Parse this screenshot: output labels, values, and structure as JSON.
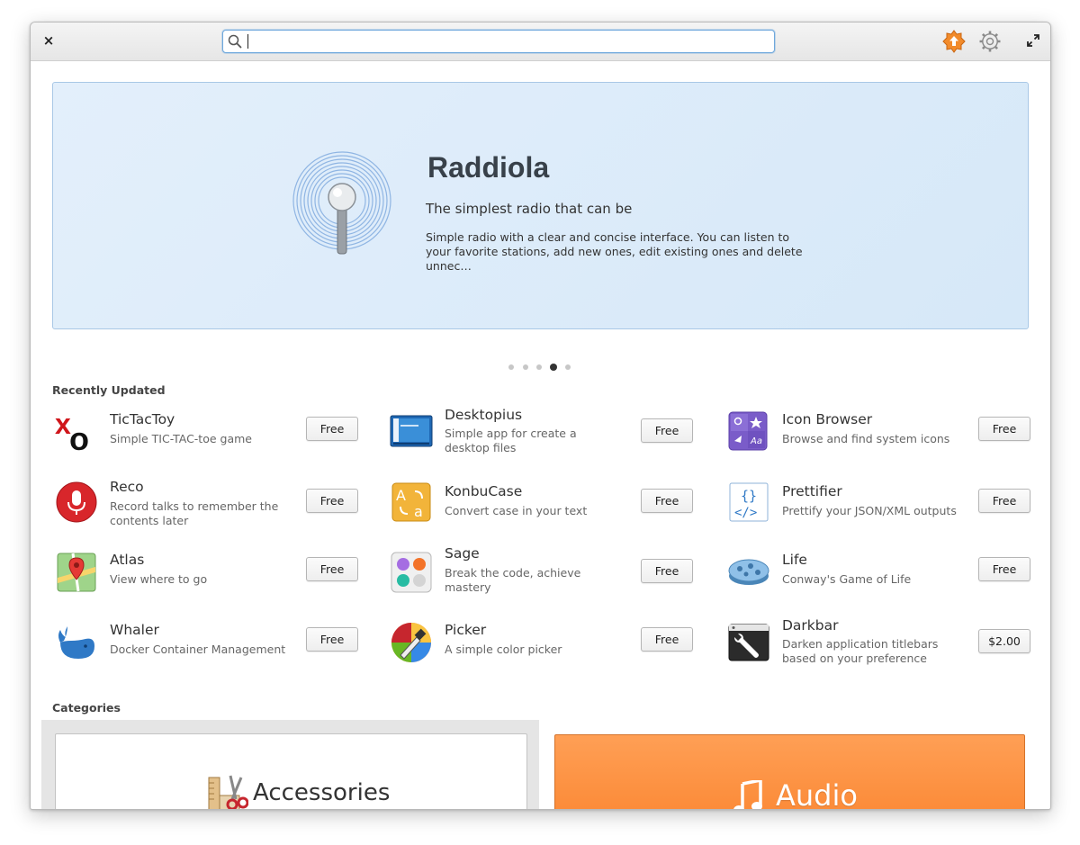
{
  "titlebar": {
    "close_symbol": "×",
    "search": {
      "value": "",
      "placeholder": ""
    },
    "icons": [
      "updates-icon",
      "settings-gear-icon",
      "maximize-icon"
    ]
  },
  "banner": {
    "title": "Raddiola",
    "subtitle": "The simplest radio that can be",
    "description": "Simple radio with a clear and concise interface. You can listen to your favorite stations, add new ones, edit existing ones and delete unnec…",
    "carousel": {
      "count": 5,
      "active_index": 3
    }
  },
  "recently_updated": {
    "title": "Recently Updated",
    "apps": [
      {
        "name": "TicTacToy",
        "description": "Simple TIC-TAC-toe game",
        "price": "Free",
        "icon": "tictactoy-icon"
      },
      {
        "name": "Desktopius",
        "description": "Simple app for create a desktop files",
        "price": "Free",
        "icon": "desktopius-icon"
      },
      {
        "name": "Icon Browser",
        "description": "Browse and find system icons",
        "price": "Free",
        "icon": "icon-browser-icon"
      },
      {
        "name": "Reco",
        "description": "Record talks to remember the contents later",
        "price": "Free",
        "icon": "microphone-icon"
      },
      {
        "name": "KonbuCase",
        "description": "Convert case in your text",
        "price": "Free",
        "icon": "konbucase-icon"
      },
      {
        "name": "Prettifier",
        "description": "Prettify your JSON/XML outputs",
        "price": "Free",
        "icon": "code-document-icon"
      },
      {
        "name": "Atlas",
        "description": "View where to go",
        "price": "Free",
        "icon": "map-icon"
      },
      {
        "name": "Sage",
        "description": "Break the code, achieve mastery",
        "price": "Free",
        "icon": "sage-icon"
      },
      {
        "name": "Life",
        "description": "Conway's Game of Life",
        "price": "Free",
        "icon": "life-petri-dish-icon"
      },
      {
        "name": "Whaler",
        "description": "Docker Container Management",
        "price": "Free",
        "icon": "whale-icon"
      },
      {
        "name": "Picker",
        "description": "A simple color picker",
        "price": "Free",
        "icon": "color-picker-icon"
      },
      {
        "name": "Darkbar",
        "description": "Darken application titlebars based on your preference",
        "price": "$2.00",
        "icon": "darkbar-icon"
      }
    ]
  },
  "categories": {
    "title": "Categories",
    "items": [
      {
        "label": "Accessories",
        "icon": "accessories-icon",
        "color": "#ffffff"
      },
      {
        "label": "Audio",
        "icon": "music-note-icon",
        "color": "#fb8a37"
      }
    ]
  },
  "colors": {
    "accent": "#6fa8dc",
    "banner_bg": "#d6e8f8",
    "updates_orange": "#f28b2b"
  }
}
